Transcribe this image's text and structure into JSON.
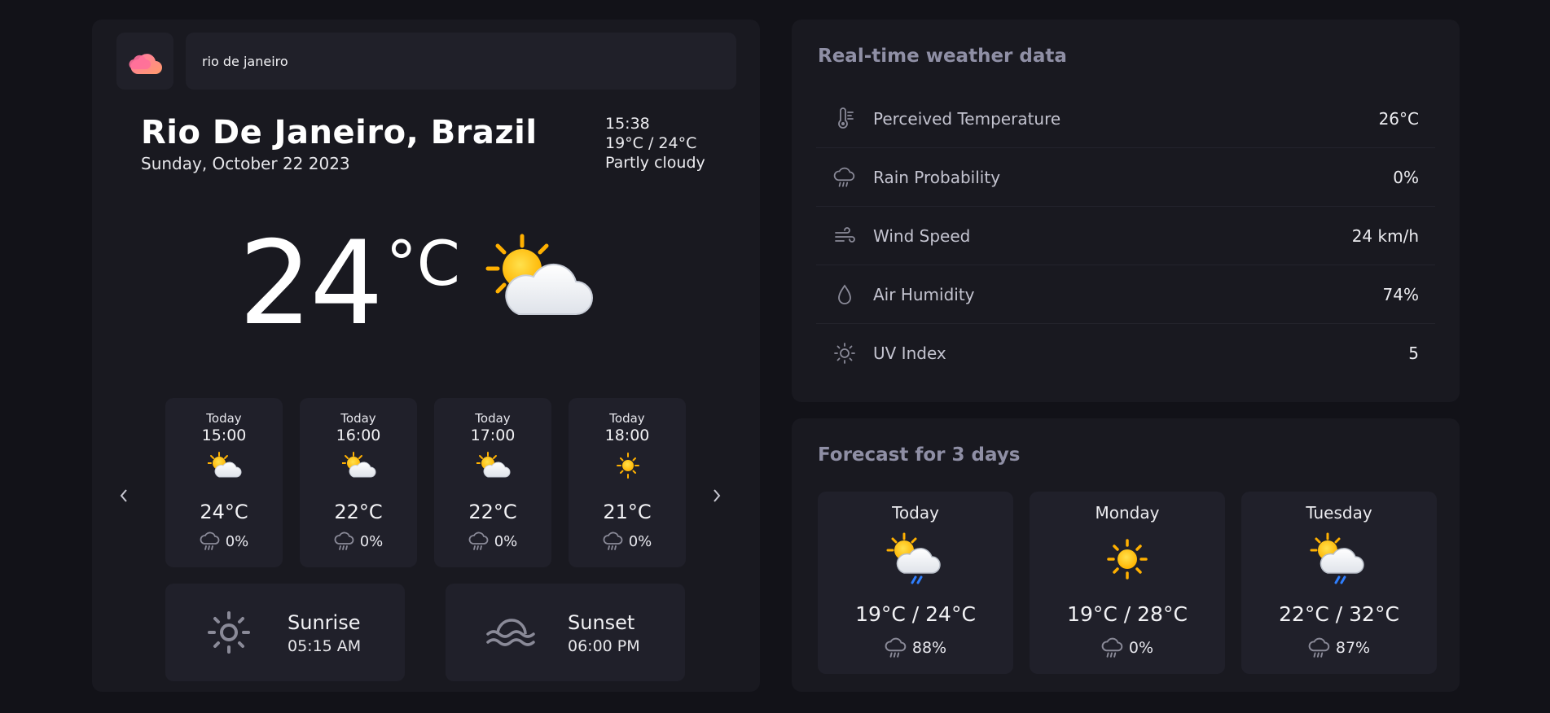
{
  "search": {
    "value": "rio de janeiro"
  },
  "location": {
    "city": "Rio De Janeiro, Brazil",
    "date": "Sunday, October 22 2023",
    "time": "15:38",
    "range": "19°C / 24°C",
    "condition": "Partly cloudy"
  },
  "current": {
    "temp": "24",
    "unit": "°C",
    "icon": "partly-cloudy-icon"
  },
  "hourly": [
    {
      "day": "Today",
      "time": "15:00",
      "icon": "partly-cloudy-icon",
      "temp": "24°C",
      "rain": "0%"
    },
    {
      "day": "Today",
      "time": "16:00",
      "icon": "partly-cloudy-icon",
      "temp": "22°C",
      "rain": "0%"
    },
    {
      "day": "Today",
      "time": "17:00",
      "icon": "partly-cloudy-icon",
      "temp": "22°C",
      "rain": "0%"
    },
    {
      "day": "Today",
      "time": "18:00",
      "icon": "sun-icon",
      "temp": "21°C",
      "rain": "0%"
    }
  ],
  "sun": {
    "sunrise_label": "Sunrise",
    "sunrise_time": "05:15 AM",
    "sunset_label": "Sunset",
    "sunset_time": "06:00 PM"
  },
  "realtime": {
    "title": "Real-time weather data",
    "rows": [
      {
        "icon": "thermometer-icon",
        "label": "Perceived Temperature",
        "value": "26°C"
      },
      {
        "icon": "rain-cloud-icon",
        "label": "Rain Probability",
        "value": "0%"
      },
      {
        "icon": "wind-icon",
        "label": "Wind Speed",
        "value": "24 km/h"
      },
      {
        "icon": "droplet-icon",
        "label": "Air Humidity",
        "value": "74%"
      },
      {
        "icon": "sun-outline-icon",
        "label": "UV Index",
        "value": "5"
      }
    ]
  },
  "forecast": {
    "title": "Forecast for 3 days",
    "days": [
      {
        "day": "Today",
        "icon": "sun-cloud-rain-icon",
        "range": "19°C / 24°C",
        "rain": "88%"
      },
      {
        "day": "Monday",
        "icon": "sun-icon",
        "range": "19°C / 28°C",
        "rain": "0%"
      },
      {
        "day": "Tuesday",
        "icon": "sun-cloud-rain-icon",
        "range": "22°C / 32°C",
        "rain": "87%"
      }
    ]
  },
  "colors": {
    "accent_pink": "#f06a8e",
    "accent_orange": "#ffb347",
    "sun_yellow": "#ffc21a",
    "panel": "#191920",
    "card": "#20202a"
  }
}
